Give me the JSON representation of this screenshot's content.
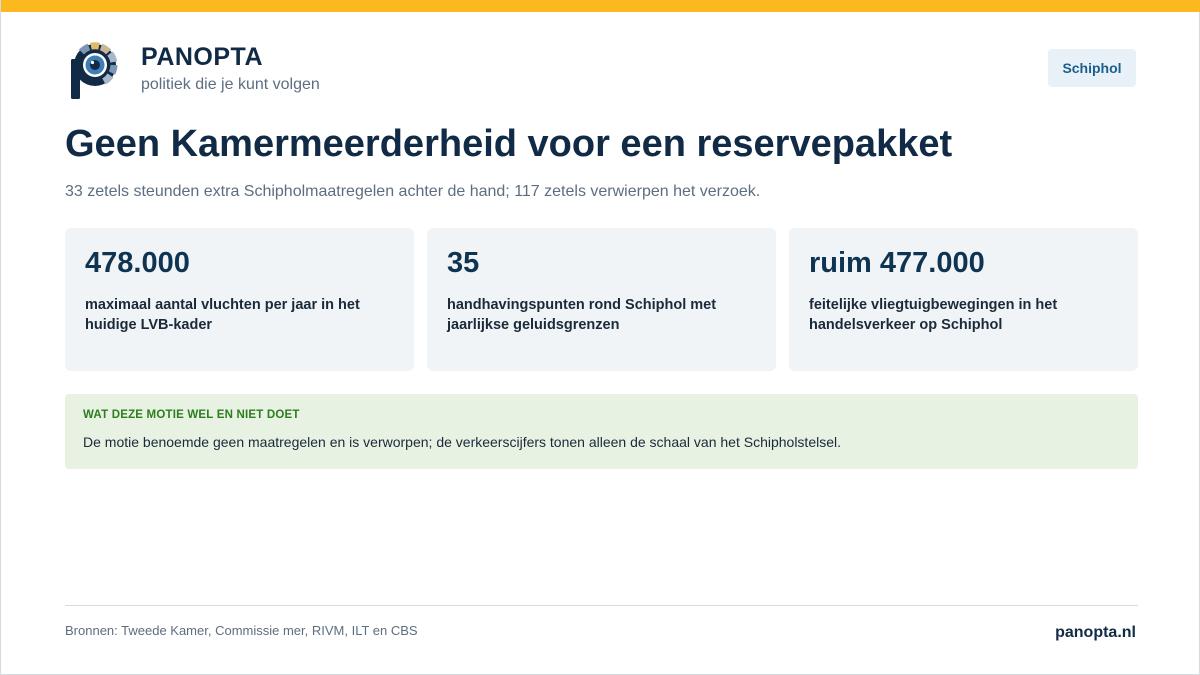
{
  "brand": {
    "name": "PANOPTA",
    "tagline": "politiek die je kunt volgen"
  },
  "tag": "Schiphol",
  "headline": "Geen Kamermeerderheid voor een reservepakket",
  "subheadline": "33 zetels steunden extra Schipholmaatregelen achter de hand; 117 zetels verwierpen het verzoek.",
  "stats": [
    {
      "value": "478.000",
      "label": "maximaal aantal vluchten per jaar in het huidige LVB-kader"
    },
    {
      "value": "35",
      "label": "handhavingspunten rond Schiphol met jaarlijkse geluidsgrenzen"
    },
    {
      "value": "ruim 477.000",
      "label": "feitelijke vliegtuigbewegingen in het handelsverkeer op Schiphol"
    }
  ],
  "note": {
    "title": "WAT DEZE MOTIE WEL EN NIET DOET",
    "text": "De motie benoemde geen maatregelen en is verworpen; de verkeerscijfers tonen alleen de schaal van het Schipholstelsel."
  },
  "footer": {
    "sources": "Bronnen: Tweede Kamer, Commissie mer, RIVM, ILT en CBS",
    "site": "panopta.nl"
  },
  "colors": {
    "accent_bar": "#fbb81f",
    "navy": "#112a45",
    "note_green": "#2e7d1e",
    "tag_blue": "#1b5f8e"
  }
}
